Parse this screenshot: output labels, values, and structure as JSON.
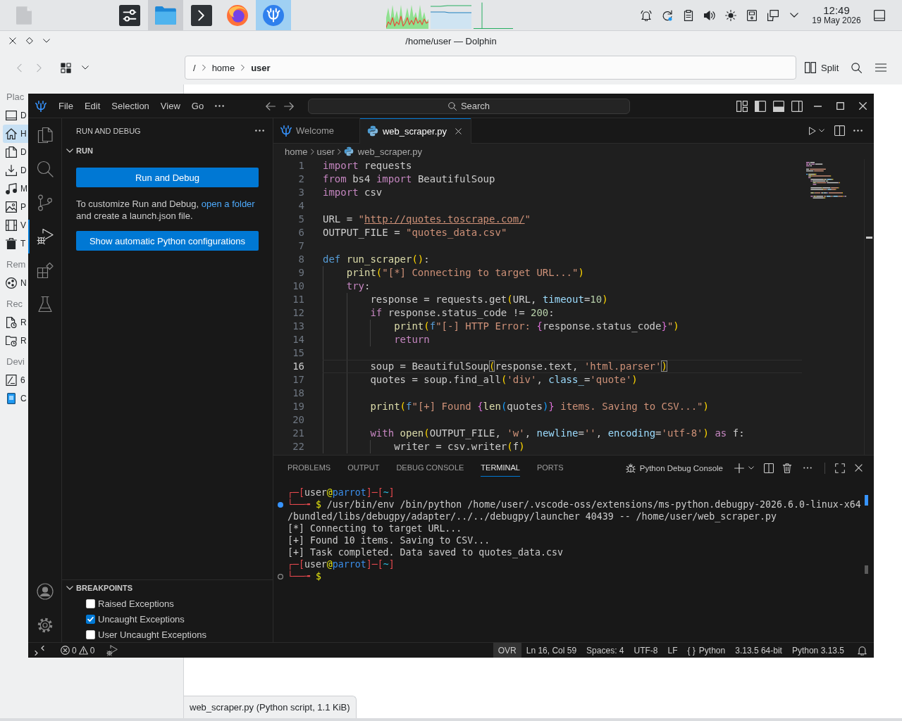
{
  "taskbar": {
    "tasks": [
      {
        "kind": "settings",
        "selected": false,
        "highlighted": false
      },
      {
        "kind": "folder",
        "selected": false,
        "highlighted": true
      },
      {
        "kind": "terminal",
        "selected": false,
        "highlighted": false
      },
      {
        "kind": "browser",
        "selected": false,
        "highlighted": false
      },
      {
        "kind": "code",
        "selected": true,
        "highlighted": false
      }
    ],
    "time": "12:49",
    "date": "19 May 2026"
  },
  "dolphin": {
    "title": "/home/user — Dolphin",
    "path": [
      {
        "label": "/",
        "current": false
      },
      {
        "label": "home",
        "current": false
      },
      {
        "label": "user",
        "current": true
      }
    ],
    "split": "Split",
    "places": [
      {
        "header": "Plac",
        "items": [
          {
            "kind": "desktop",
            "label": "D",
            "selected": false
          },
          {
            "kind": "home",
            "label": "H",
            "selected": true
          },
          {
            "kind": "documents",
            "label": "D",
            "selected": false
          },
          {
            "kind": "downloads",
            "label": "D",
            "selected": false
          },
          {
            "kind": "music",
            "label": "M",
            "selected": false
          },
          {
            "kind": "pictures",
            "label": "P",
            "selected": false
          },
          {
            "kind": "videos",
            "label": "V",
            "selected": false
          },
          {
            "kind": "trash",
            "label": "T",
            "selected": false
          }
        ]
      },
      {
        "header": "Rem",
        "items": [
          {
            "kind": "network",
            "label": "N",
            "selected": false
          }
        ]
      },
      {
        "header": "Rec",
        "items": [
          {
            "kind": "recent-files",
            "label": "R",
            "selected": false
          },
          {
            "kind": "recent-locations",
            "label": "R",
            "selected": false
          }
        ]
      },
      {
        "header": "Devi",
        "items": [
          {
            "kind": "disk",
            "label": "6",
            "selected": false
          },
          {
            "kind": "phone",
            "label": "C",
            "selected": false
          }
        ]
      }
    ],
    "status": "web_scraper.py (Python script, 1.1 KiB)"
  },
  "vscode": {
    "menu": [
      "File",
      "Edit",
      "Selection",
      "View",
      "Go"
    ],
    "command_center": "Search",
    "activity": [
      {
        "kind": "explorer",
        "selected": false
      },
      {
        "kind": "search",
        "selected": false
      },
      {
        "kind": "source-control",
        "selected": false
      },
      {
        "kind": "run-debug",
        "selected": true
      },
      {
        "kind": "extensions",
        "selected": false
      },
      {
        "kind": "testing",
        "selected": false
      }
    ],
    "sidebar": {
      "title": "RUN AND DEBUG",
      "section": {
        "title": "RUN",
        "expanded": true
      },
      "run_button": "Run and Debug",
      "help": {
        "before": "To customize Run and Debug,",
        "link": "open a folder",
        "after": "and create a launch.json file."
      },
      "config_button": "Show automatic Python configurations",
      "breakpoints": {
        "title": "BREAKPOINTS",
        "expanded": true,
        "items": [
          {
            "label": "Raised Exceptions",
            "checked": false
          },
          {
            "label": "Uncaught Exceptions",
            "checked": true
          },
          {
            "label": "User Uncaught Exceptions",
            "checked": false
          }
        ]
      }
    },
    "tabs": [
      {
        "label": "Welcome",
        "kind": "welcome",
        "selected": false
      },
      {
        "label": "web_scraper.py",
        "kind": "python",
        "selected": true
      }
    ],
    "breadcrumb": [
      {
        "label": "home",
        "kind": "folder"
      },
      {
        "label": "user",
        "kind": "folder"
      },
      {
        "label": "web_scraper.py",
        "kind": "python"
      }
    ],
    "code": [
      {
        "n": "1",
        "current": false,
        "tokens": [
          {
            "text": "import",
            "kind": "keyword"
          },
          {
            "text": " requests",
            "kind": "plain"
          }
        ]
      },
      {
        "n": "2",
        "current": false,
        "tokens": [
          {
            "text": "from",
            "kind": "keyword"
          },
          {
            "text": " bs4 ",
            "kind": "plain"
          },
          {
            "text": "import",
            "kind": "keyword"
          },
          {
            "text": " BeautifulSoup",
            "kind": "plain"
          }
        ]
      },
      {
        "n": "3",
        "current": false,
        "tokens": [
          {
            "text": "import",
            "kind": "keyword"
          },
          {
            "text": " csv",
            "kind": "plain"
          }
        ]
      },
      {
        "n": "4",
        "current": false
      },
      {
        "n": "5",
        "current": false,
        "tokens": [
          {
            "text": "URL = ",
            "kind": "plain"
          },
          {
            "text": "\"",
            "kind": "string"
          },
          {
            "text": "http://quotes.toscrape.com/",
            "kind": "link"
          },
          {
            "text": "\"",
            "kind": "string"
          }
        ]
      },
      {
        "n": "6",
        "current": false,
        "tokens": [
          {
            "text": "OUTPUT_FILE = ",
            "kind": "plain"
          },
          {
            "text": "\"quotes_data.csv\"",
            "kind": "string"
          }
        ]
      },
      {
        "n": "7",
        "current": false
      },
      {
        "n": "8",
        "current": false,
        "tokens": [
          {
            "text": "def ",
            "kind": "storage"
          },
          {
            "text": "run_scraper",
            "kind": "function"
          },
          {
            "text": "()",
            "kind": "bracket1"
          },
          {
            "text": ":",
            "kind": "plain"
          }
        ]
      },
      {
        "n": "9",
        "current": false,
        "tokens": [
          {
            "text": "    print",
            "kind": "function"
          },
          {
            "text": "(",
            "kind": "bracket1"
          },
          {
            "text": "\"[*] Connecting to target URL...\"",
            "kind": "string"
          },
          {
            "text": ")",
            "kind": "bracket1"
          }
        ]
      },
      {
        "n": "10",
        "current": false,
        "tokens": [
          {
            "text": "    try",
            "kind": "keyword"
          },
          {
            "text": ":",
            "kind": "plain"
          }
        ]
      },
      {
        "n": "11",
        "current": false,
        "tokens": [
          {
            "text": "        response = requests.get",
            "kind": "plain"
          },
          {
            "text": "(",
            "kind": "bracket1"
          },
          {
            "text": "URL, ",
            "kind": "plain"
          },
          {
            "text": "timeout",
            "kind": "parameter"
          },
          {
            "text": "=",
            "kind": "plain"
          },
          {
            "text": "10",
            "kind": "number"
          },
          {
            "text": ")",
            "kind": "bracket1"
          }
        ]
      },
      {
        "n": "12",
        "current": false,
        "tokens": [
          {
            "text": "        if",
            "kind": "keyword"
          },
          {
            "text": " response.status_code != ",
            "kind": "plain"
          },
          {
            "text": "200",
            "kind": "number"
          },
          {
            "text": ":",
            "kind": "plain"
          }
        ]
      },
      {
        "n": "13",
        "current": false,
        "tokens": [
          {
            "text": "            print",
            "kind": "function"
          },
          {
            "text": "(",
            "kind": "bracket1"
          },
          {
            "text": "f",
            "kind": "storage"
          },
          {
            "text": "\"[-] HTTP Error: ",
            "kind": "string"
          },
          {
            "text": "{",
            "kind": "bracket2"
          },
          {
            "text": "response.status_code",
            "kind": "plain"
          },
          {
            "text": "}",
            "kind": "bracket2"
          },
          {
            "text": "\"",
            "kind": "string"
          },
          {
            "text": ")",
            "kind": "bracket1"
          }
        ]
      },
      {
        "n": "14",
        "current": false,
        "tokens": [
          {
            "text": "            return",
            "kind": "keyword"
          }
        ]
      },
      {
        "n": "15",
        "current": false
      },
      {
        "n": "16",
        "current": true,
        "tokens": [
          {
            "text": "        soup = BeautifulSoup",
            "kind": "plain"
          },
          {
            "text": "(",
            "kind": "match"
          },
          {
            "text": "response.text, ",
            "kind": "plain"
          },
          {
            "text": "'html.parser'",
            "kind": "string"
          },
          {
            "text": ")",
            "kind": "match"
          }
        ]
      },
      {
        "n": "17",
        "current": false,
        "tokens": [
          {
            "text": "        quotes = soup.find_all",
            "kind": "plain"
          },
          {
            "text": "(",
            "kind": "bracket1"
          },
          {
            "text": "'div'",
            "kind": "string"
          },
          {
            "text": ", ",
            "kind": "plain"
          },
          {
            "text": "class_",
            "kind": "parameter"
          },
          {
            "text": "=",
            "kind": "plain"
          },
          {
            "text": "'quote'",
            "kind": "string"
          },
          {
            "text": ")",
            "kind": "bracket1"
          }
        ]
      },
      {
        "n": "18",
        "current": false
      },
      {
        "n": "19",
        "current": false,
        "tokens": [
          {
            "text": "        print",
            "kind": "function"
          },
          {
            "text": "(",
            "kind": "bracket1"
          },
          {
            "text": "f",
            "kind": "storage"
          },
          {
            "text": "\"[+] Found ",
            "kind": "string"
          },
          {
            "text": "{",
            "kind": "bracket2"
          },
          {
            "text": "len",
            "kind": "function"
          },
          {
            "text": "(",
            "kind": "bracket3"
          },
          {
            "text": "quotes",
            "kind": "plain"
          },
          {
            "text": ")",
            "kind": "bracket3"
          },
          {
            "text": "}",
            "kind": "bracket2"
          },
          {
            "text": " items. Saving to CSV...\"",
            "kind": "string"
          },
          {
            "text": ")",
            "kind": "bracket1"
          }
        ]
      },
      {
        "n": "20",
        "current": false
      },
      {
        "n": "21",
        "current": false,
        "tokens": [
          {
            "text": "        with",
            "kind": "keyword"
          },
          {
            "text": " open",
            "kind": "function"
          },
          {
            "text": "(",
            "kind": "bracket1"
          },
          {
            "text": "OUTPUT_FILE, ",
            "kind": "plain"
          },
          {
            "text": "'w'",
            "kind": "string"
          },
          {
            "text": ", ",
            "kind": "plain"
          },
          {
            "text": "newline",
            "kind": "parameter"
          },
          {
            "text": "=",
            "kind": "plain"
          },
          {
            "text": "''",
            "kind": "string"
          },
          {
            "text": ", ",
            "kind": "plain"
          },
          {
            "text": "encoding",
            "kind": "parameter"
          },
          {
            "text": "=",
            "kind": "plain"
          },
          {
            "text": "'utf-8'",
            "kind": "string"
          },
          {
            "text": ")",
            "kind": "bracket1"
          },
          {
            "text": " as",
            "kind": "keyword"
          },
          {
            "text": " f:",
            "kind": "plain"
          }
        ]
      },
      {
        "n": "22",
        "current": false,
        "tokens": [
          {
            "text": "            writer = csv.writer",
            "kind": "plain"
          },
          {
            "text": "(",
            "kind": "bracket1"
          },
          {
            "text": "f",
            "kind": "plain"
          },
          {
            "text": ")",
            "kind": "bracket1"
          }
        ]
      }
    ],
    "panel": {
      "tabs": [
        {
          "label": "PROBLEMS",
          "selected": false
        },
        {
          "label": "OUTPUT",
          "selected": false
        },
        {
          "label": "DEBUG CONSOLE",
          "selected": false
        },
        {
          "label": "TERMINAL",
          "selected": true
        },
        {
          "label": "PORTS",
          "selected": false
        }
      ],
      "terminal_name": "Python Debug Console",
      "terminal": [
        {
          "segments": [
            {
              "text": "┌─[",
              "kind": "frame"
            },
            {
              "text": "user",
              "kind": "user"
            },
            {
              "text": "@",
              "kind": "at"
            },
            {
              "text": "parrot",
              "kind": "host"
            },
            {
              "text": "]─[",
              "kind": "frame"
            },
            {
              "text": "~",
              "kind": "path"
            },
            {
              "text": "]",
              "kind": "frame"
            }
          ]
        },
        {
          "finished": true,
          "segments": [
            {
              "text": "└──╼",
              "kind": "frame"
            },
            {
              "text": " $",
              "kind": "prompt"
            },
            {
              "text": " /usr/bin/env /bin/python /home/user/.vscode-oss/extensions/ms-python.debugpy-2026.6.0-linux-x64",
              "kind": "output"
            }
          ]
        },
        {
          "segments": [
            {
              "text": "/bundled/libs/debugpy/adapter/../../debugpy/launcher 40439 -- /home/user/web_scraper.py",
              "kind": "output"
            }
          ]
        },
        {
          "segments": [
            {
              "text": "[*] Connecting to target URL...",
              "kind": "output"
            }
          ]
        },
        {
          "segments": [
            {
              "text": "[+] Found 10 items. Saving to CSV...",
              "kind": "output"
            }
          ]
        },
        {
          "segments": [
            {
              "text": "[+] Task completed. Data saved to quotes_data.csv",
              "kind": "output"
            }
          ]
        },
        {
          "segments": [
            {
              "text": "┌─[",
              "kind": "frame"
            },
            {
              "text": "user",
              "kind": "user"
            },
            {
              "text": "@",
              "kind": "at"
            },
            {
              "text": "parrot",
              "kind": "host"
            },
            {
              "text": "]─[",
              "kind": "frame"
            },
            {
              "text": "~",
              "kind": "path"
            },
            {
              "text": "]",
              "kind": "frame"
            }
          ]
        },
        {
          "finished": false,
          "segments": [
            {
              "text": "└──╼",
              "kind": "frame"
            },
            {
              "text": " $",
              "kind": "prompt"
            }
          ]
        }
      ]
    },
    "status": {
      "errors": "0",
      "warnings": "0",
      "items": [
        {
          "kind": "mode",
          "label": "OVR"
        },
        {
          "kind": "plain",
          "label": "Ln 16, Col 59"
        },
        {
          "kind": "plain",
          "label": "Spaces: 4"
        },
        {
          "kind": "plain",
          "label": "UTF-8"
        },
        {
          "kind": "plain",
          "label": "LF"
        },
        {
          "kind": "language",
          "glyph": "{ }",
          "label": "Python"
        },
        {
          "kind": "plain",
          "label": "3.13.5 64-bit"
        },
        {
          "kind": "plain",
          "label": "Python 3.13.5"
        }
      ]
    }
  }
}
